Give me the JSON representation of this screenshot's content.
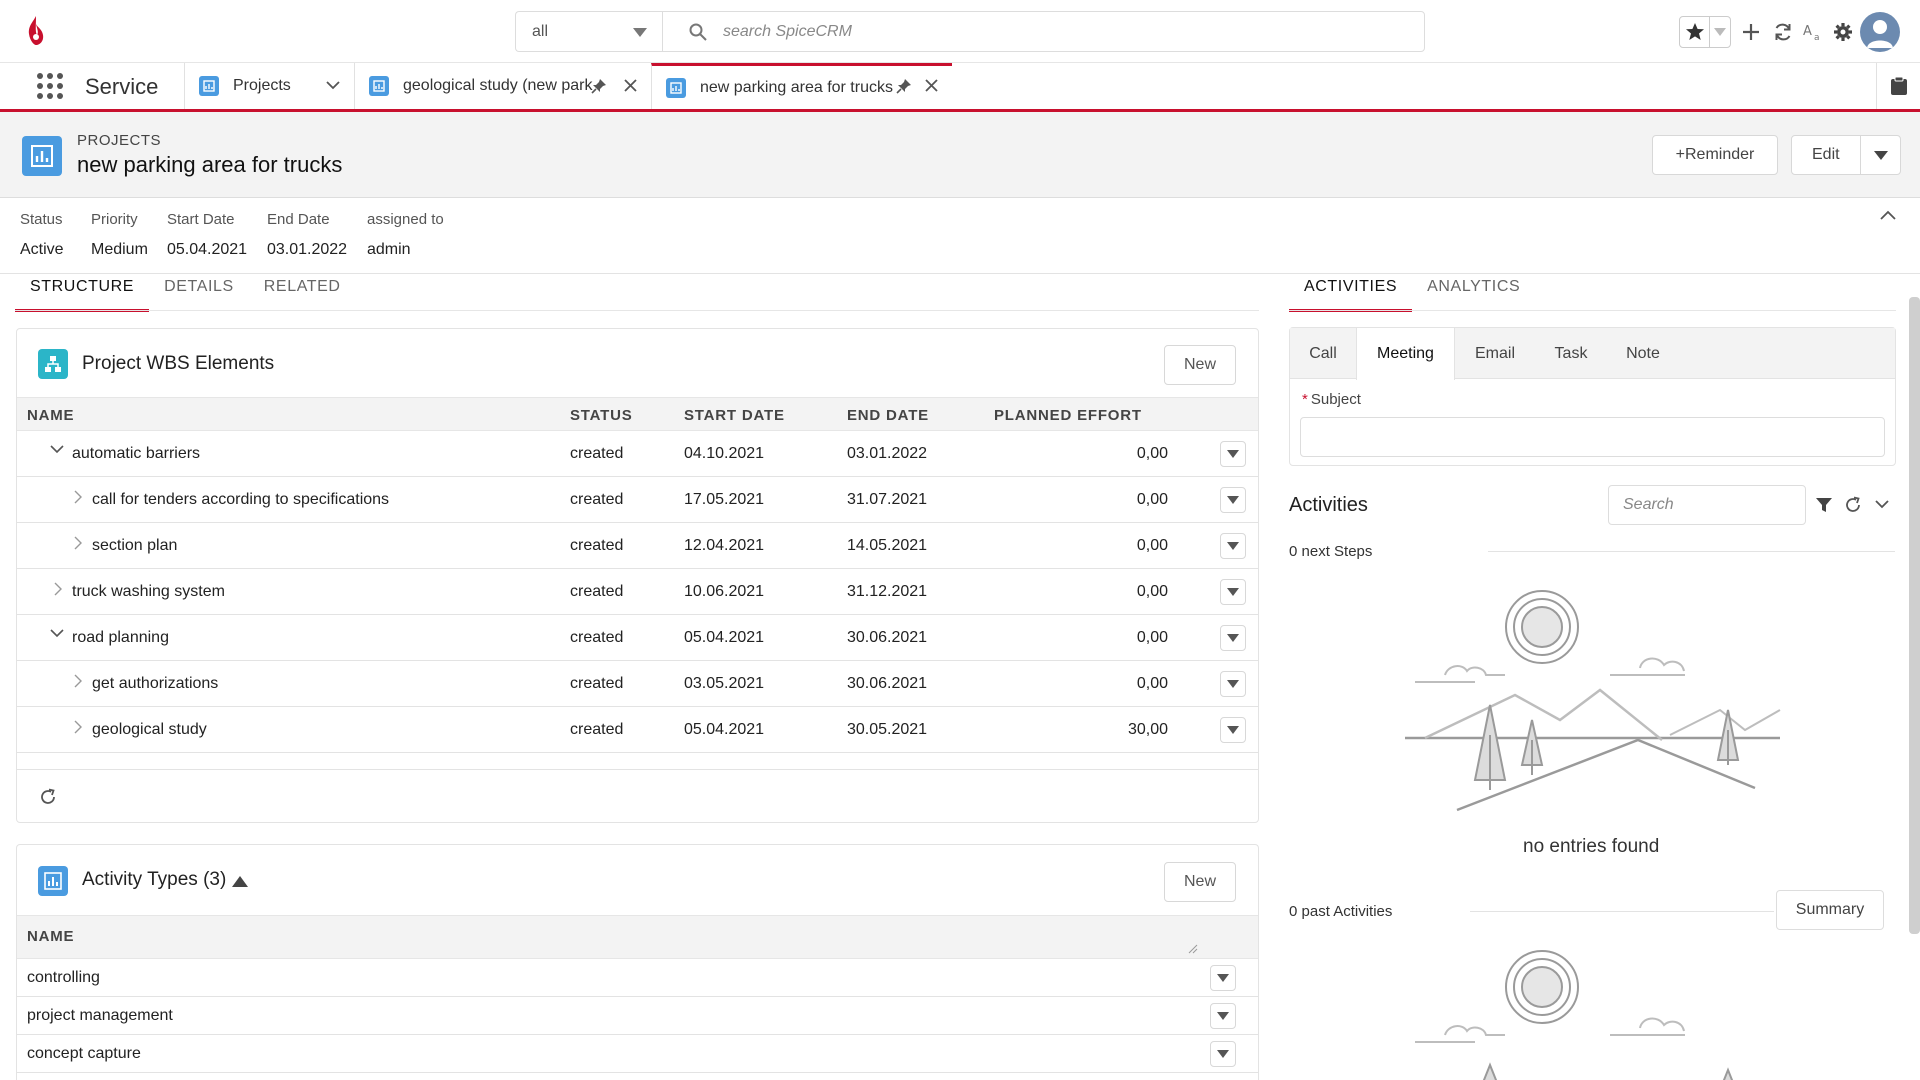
{
  "search": {
    "scope": "all",
    "placeholder": "search SpiceCRM"
  },
  "nav": {
    "module": "Service",
    "tabs": [
      {
        "label": "Projects"
      },
      {
        "label": "geological study (new parkir"
      },
      {
        "label": "new parking area for trucks"
      }
    ]
  },
  "record": {
    "type_label": "PROJECTS",
    "title": "new parking area for trucks",
    "reminder_label": "+Reminder",
    "edit_label": "Edit"
  },
  "summary": {
    "fields": [
      {
        "label": "Status",
        "value": "Active"
      },
      {
        "label": "Priority",
        "value": "Medium"
      },
      {
        "label": "Start Date",
        "value": "05.04.2021"
      },
      {
        "label": "End Date",
        "value": "03.01.2022"
      },
      {
        "label": "assigned to",
        "value": "admin"
      }
    ]
  },
  "left_tabs": [
    "STRUCTURE",
    "DETAILS",
    "RELATED"
  ],
  "right_tabs": [
    "ACTIVITIES",
    "ANALYTICS"
  ],
  "wbs": {
    "title": "Project WBS Elements",
    "new_label": "New",
    "columns": [
      "NAME",
      "STATUS",
      "START DATE",
      "END DATE",
      "PLANNED EFFORT"
    ],
    "rows": [
      {
        "name": "automatic barriers",
        "status": "created",
        "start": "04.10.2021",
        "end": "03.01.2022",
        "effort": "0,00"
      },
      {
        "name": "call for tenders according to specifications",
        "status": "created",
        "start": "17.05.2021",
        "end": "31.07.2021",
        "effort": "0,00"
      },
      {
        "name": "section plan",
        "status": "created",
        "start": "12.04.2021",
        "end": "14.05.2021",
        "effort": "0,00"
      },
      {
        "name": "truck washing system",
        "status": "created",
        "start": "10.06.2021",
        "end": "31.12.2021",
        "effort": "0,00"
      },
      {
        "name": "road planning",
        "status": "created",
        "start": "05.04.2021",
        "end": "30.06.2021",
        "effort": "0,00"
      },
      {
        "name": "get authorizations",
        "status": "created",
        "start": "03.05.2021",
        "end": "30.06.2021",
        "effort": "0,00"
      },
      {
        "name": "geological study",
        "status": "created",
        "start": "05.04.2021",
        "end": "30.05.2021",
        "effort": "30,00"
      }
    ]
  },
  "activity_types": {
    "title": "Activity Types (3)",
    "new_label": "New",
    "column": "NAME",
    "rows": [
      "controlling",
      "project management",
      "concept capture"
    ]
  },
  "activities": {
    "compose_tabs": [
      "Call",
      "Meeting",
      "Email",
      "Task",
      "Note"
    ],
    "subject_label": "Subject",
    "required_mark": "*",
    "title": "Activities",
    "search_placeholder": "Search",
    "next_steps": "0 next Steps",
    "no_entries": "no entries found",
    "past": "0 past Activities",
    "summary_label": "Summary"
  },
  "colors": {
    "accent": "#c8102e",
    "module_icon": "#4a9be0",
    "wbs_icon": "#2bb5c8"
  }
}
